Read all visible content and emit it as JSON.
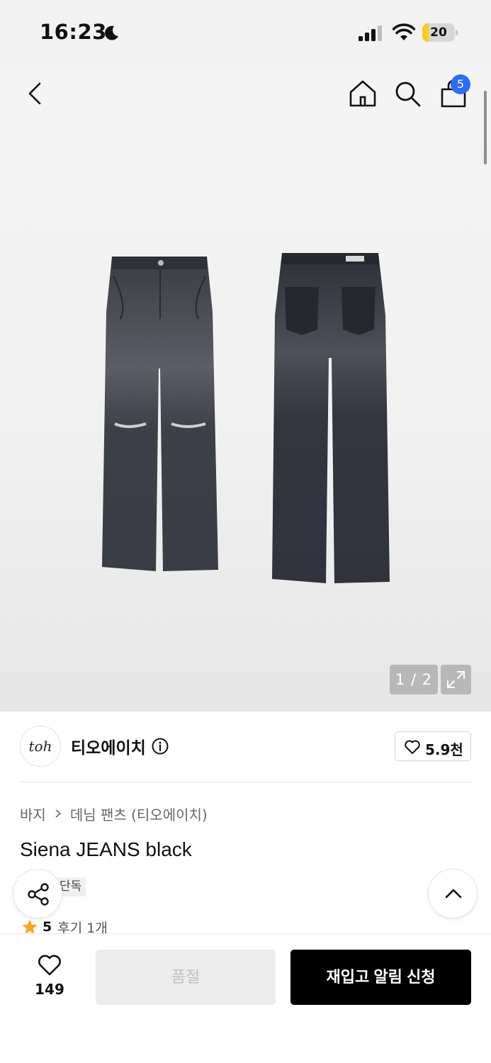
{
  "status_bar": {
    "time": "16:23",
    "battery_level": "20",
    "battery_fraction": 0.2,
    "icons": [
      "moon-icon",
      "signal-icon",
      "wifi-icon",
      "battery-icon"
    ]
  },
  "header": {
    "icons": [
      "chevron-left-icon",
      "home-icon",
      "search-icon",
      "bag-icon"
    ],
    "cart_badge": "5"
  },
  "gallery": {
    "page_counter": "1 / 2",
    "current_image": 1,
    "total_images": 2,
    "images": [
      "jeans-front-image",
      "jeans-back-image"
    ]
  },
  "brand": {
    "logo_text": "toh",
    "name": "티오에이치",
    "follow_count": "5.9천"
  },
  "breadcrumb": {
    "category": "바지",
    "subcategory": "데님 팬츠 (티오에이치)"
  },
  "product": {
    "title": "Siena JEANS black",
    "exclusive_badge": "단독",
    "rating": "5",
    "review_label": "후기 1개"
  },
  "bottom_bar": {
    "wishlist_count": "149",
    "soldout_label": "품절",
    "restock_label": "재입고 알림 신청"
  },
  "colors": {
    "accent_blue": "#2c6cf6",
    "star": "#f5a623",
    "battery": "#f5cf18",
    "primary_button": "#000000"
  }
}
